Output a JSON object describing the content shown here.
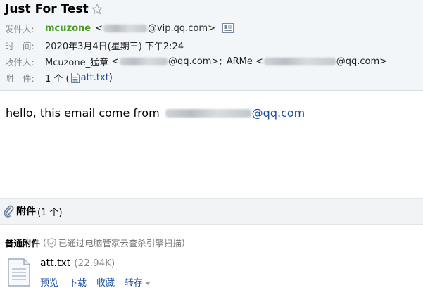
{
  "subject": "Just For Test",
  "from": {
    "label": "发件人:",
    "name": "mcuzone",
    "open": "<",
    "domain": "@vip.qq.com>"
  },
  "time": {
    "label": "时　间:",
    "value": "2020年3月4日(星期三) 下午2:24"
  },
  "to": {
    "label": "收件人:",
    "first_name": "Mcuzone_猛章",
    "first_open": "<",
    "first_domain": "@qq.com>;",
    "second_name": "ARMe",
    "second_open": "<",
    "second_domain": "@qq.com>"
  },
  "attach_line": {
    "label": "附　件:",
    "count_prefix": "1 个 (",
    "file": "att.txt",
    "close": ")"
  },
  "body": {
    "text": "hello, this email come from",
    "domain": "@qq.com"
  },
  "attachments": {
    "title": "附件",
    "count": "(1 个)",
    "normal_label": "普通附件",
    "scan_text": "已通过电脑管家云查杀引擎扫描",
    "file_name": "att.txt",
    "file_size": "(22.94K)",
    "actions": [
      "预览",
      "下载",
      "收藏",
      "转存"
    ]
  },
  "colors": {
    "sender": "#4b9c26",
    "link": "#1a4da1",
    "header_bg": "#f3f6f9"
  }
}
